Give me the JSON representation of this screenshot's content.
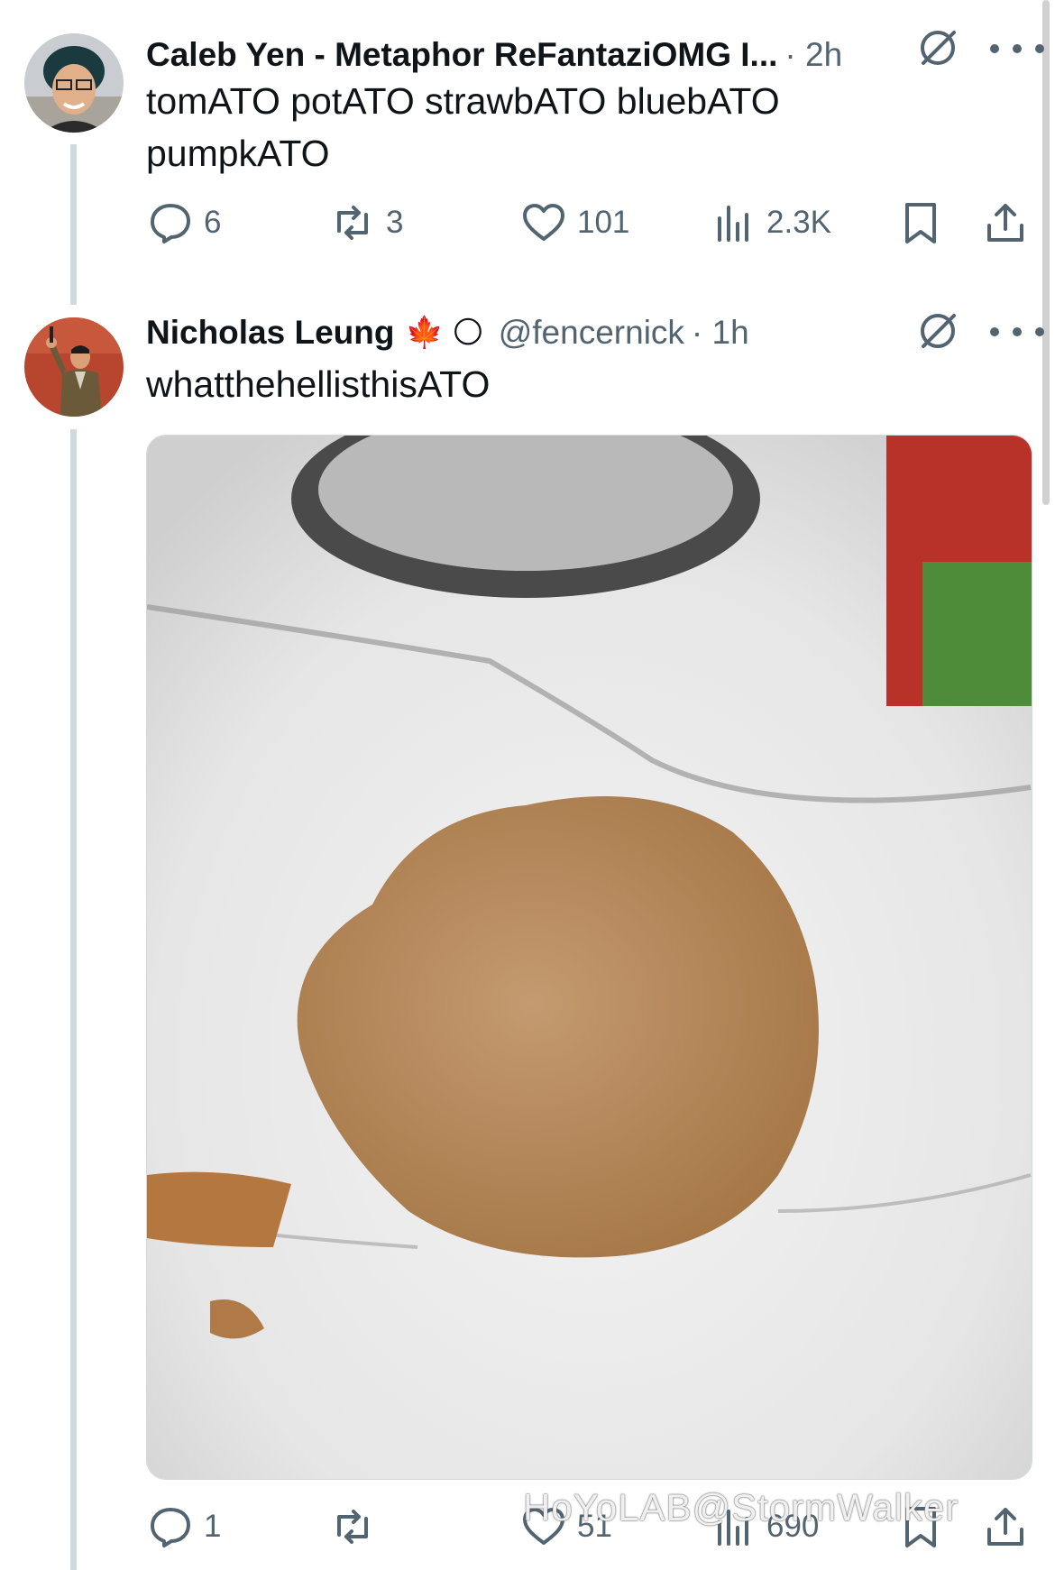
{
  "tweets": [
    {
      "name": "Caleb Yen - Metaphor ReFantaziOMG I...",
      "handle": "",
      "time": "· 2h",
      "text": "tomATO potATO strawbATO bluebATO pumpkATO",
      "stats": {
        "replies": "6",
        "reposts": "3",
        "likes": "101",
        "views": "2.3K"
      }
    },
    {
      "name": "Nicholas Leung",
      "emoji": "🍁 🌕",
      "handle": "@fencernick",
      "time": "· 1h",
      "text": "whatthehellisthisATO",
      "stats": {
        "replies": "1",
        "reposts": "",
        "likes": "51",
        "views": "690"
      }
    }
  ],
  "watermark": "HoYoLAB@StormWalker",
  "icons": [
    "grok-icon",
    "more-icon",
    "reply-icon",
    "repost-icon",
    "like-icon",
    "views-icon",
    "bookmark-icon",
    "share-icon"
  ],
  "colors": {
    "text": "#0f1419",
    "secondary": "#536471",
    "thread_line": "#cfd9de"
  }
}
